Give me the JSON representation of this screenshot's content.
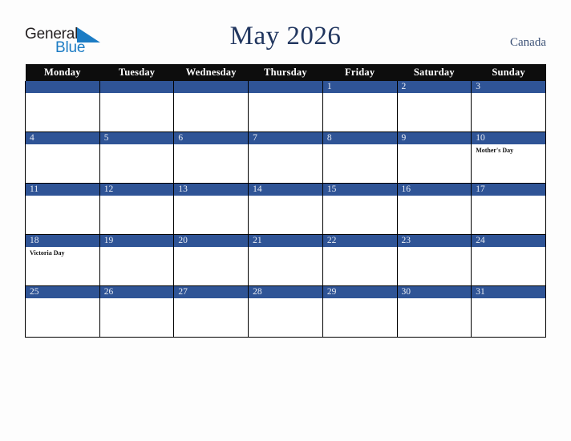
{
  "brand": {
    "name_part1": "General",
    "name_part2": "Blue",
    "triangle_color": "#1c7cc4",
    "text_color": "#231f20"
  },
  "header": {
    "title": "May 2026",
    "country": "Canada",
    "title_color": "#21365f",
    "country_color": "#3a5075"
  },
  "calendar": {
    "weekday_headers": [
      "Monday",
      "Tuesday",
      "Wednesday",
      "Thursday",
      "Friday",
      "Saturday",
      "Sunday"
    ],
    "header_bg": "#0d0d0d",
    "date_bar_bg": "#2f5496",
    "date_text_color": "#e8ecf4",
    "cell_bg": "#ffffff",
    "border_color": "#000000",
    "weeks": [
      [
        {
          "date": "",
          "events": []
        },
        {
          "date": "",
          "events": []
        },
        {
          "date": "",
          "events": []
        },
        {
          "date": "",
          "events": []
        },
        {
          "date": "1",
          "events": []
        },
        {
          "date": "2",
          "events": []
        },
        {
          "date": "3",
          "events": []
        }
      ],
      [
        {
          "date": "4",
          "events": []
        },
        {
          "date": "5",
          "events": []
        },
        {
          "date": "6",
          "events": []
        },
        {
          "date": "7",
          "events": []
        },
        {
          "date": "8",
          "events": []
        },
        {
          "date": "9",
          "events": []
        },
        {
          "date": "10",
          "events": [
            "Mother's Day"
          ]
        }
      ],
      [
        {
          "date": "11",
          "events": []
        },
        {
          "date": "12",
          "events": []
        },
        {
          "date": "13",
          "events": []
        },
        {
          "date": "14",
          "events": []
        },
        {
          "date": "15",
          "events": []
        },
        {
          "date": "16",
          "events": []
        },
        {
          "date": "17",
          "events": []
        }
      ],
      [
        {
          "date": "18",
          "events": [
            "Victoria Day"
          ]
        },
        {
          "date": "19",
          "events": []
        },
        {
          "date": "20",
          "events": []
        },
        {
          "date": "21",
          "events": []
        },
        {
          "date": "22",
          "events": []
        },
        {
          "date": "23",
          "events": []
        },
        {
          "date": "24",
          "events": []
        }
      ],
      [
        {
          "date": "25",
          "events": []
        },
        {
          "date": "26",
          "events": []
        },
        {
          "date": "27",
          "events": []
        },
        {
          "date": "28",
          "events": []
        },
        {
          "date": "29",
          "events": []
        },
        {
          "date": "30",
          "events": []
        },
        {
          "date": "31",
          "events": []
        }
      ]
    ]
  }
}
